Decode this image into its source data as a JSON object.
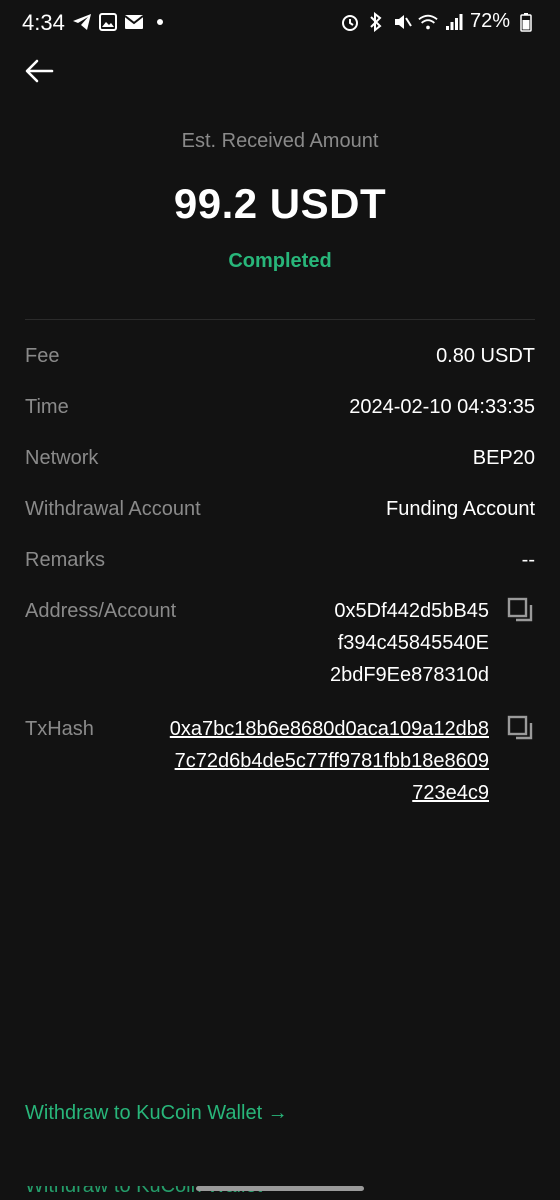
{
  "status_bar": {
    "time": "4:34",
    "battery": "72%"
  },
  "summary": {
    "est_label": "Est. Received Amount",
    "amount": "99.2 USDT",
    "status": "Completed"
  },
  "details": {
    "fee": {
      "label": "Fee",
      "value": "0.80 USDT"
    },
    "time": {
      "label": "Time",
      "value": "2024-02-10 04:33:35"
    },
    "network": {
      "label": "Network",
      "value": "BEP20"
    },
    "withdrawal_account": {
      "label": "Withdrawal Account",
      "value": "Funding Account"
    },
    "remarks": {
      "label": "Remarks",
      "value": "--"
    },
    "address": {
      "label": "Address/Account",
      "value": "0x5Df442d5bB45f394c45845540E2bdF9Ee878310d"
    },
    "txhash": {
      "label": "TxHash",
      "value": "0xa7bc18b6e8680d0aca109a12db87c72d6b4de5c77ff9781fbb18e8609723e4c9"
    }
  },
  "footer": {
    "link": "Withdraw to KuCoin Wallet →",
    "ghost_link": "Withdraw to KuCoin Wallet →"
  },
  "colors": {
    "background": "#121212",
    "accent": "#28b67a",
    "muted": "#8a8a8a"
  }
}
